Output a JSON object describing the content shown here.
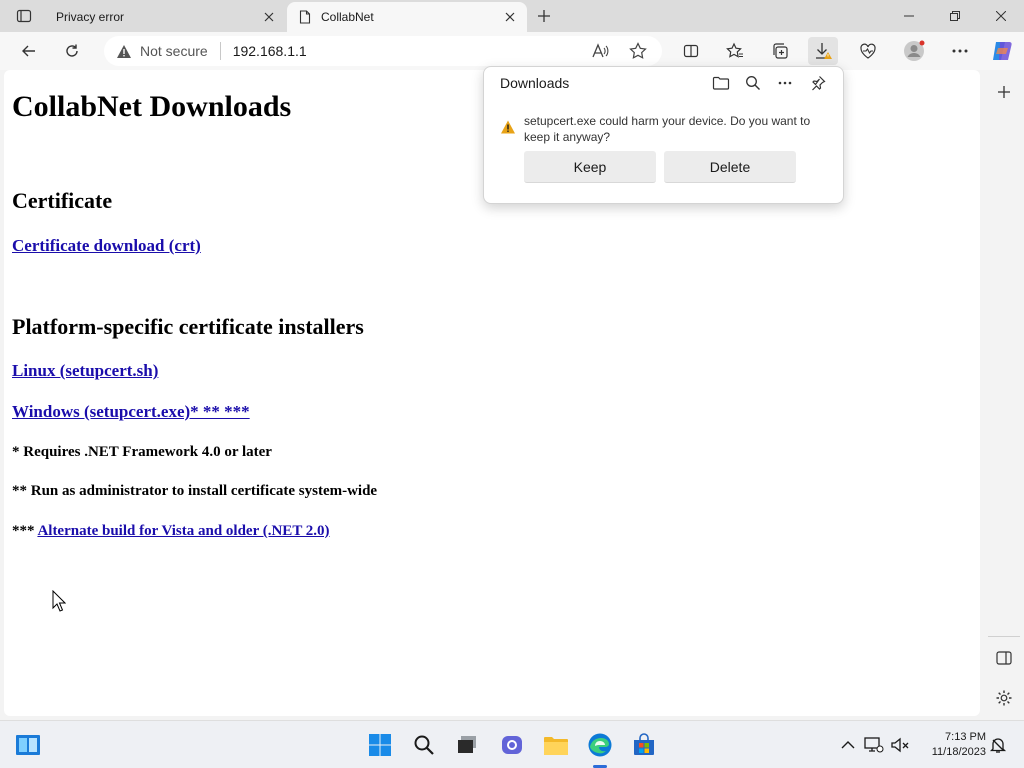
{
  "tabs": [
    {
      "title": "Privacy error",
      "active": false
    },
    {
      "title": "CollabNet",
      "active": true
    }
  ],
  "toolbar": {
    "security_label": "Not secure",
    "url": "192.168.1.1"
  },
  "page": {
    "title": "CollabNet Downloads",
    "sections": {
      "certificate_heading": "Certificate",
      "certificate_link": "Certificate download (crt)",
      "installers_heading": "Platform-specific certificate installers",
      "linux_link": "Linux (setupcert.sh)",
      "windows_link": "Windows (setupcert.exe)* ** ***",
      "note1": "* Requires .NET Framework 4.0 or later",
      "note2": "** Run as administrator to install certificate system-wide",
      "note3_prefix": "***",
      "note3_link": "Alternate build for Vista and older (.NET 2.0)"
    }
  },
  "downloads_panel": {
    "title": "Downloads",
    "message": "setupcert.exe could harm your device. Do you want to keep it anyway?",
    "keep_label": "Keep",
    "delete_label": "Delete"
  },
  "taskbar": {
    "time": "7:13 PM",
    "date": "11/18/2023"
  },
  "icons": {
    "warning": "warning-icon",
    "accent": "#1a0dab",
    "warning_color": "#e8a317"
  }
}
